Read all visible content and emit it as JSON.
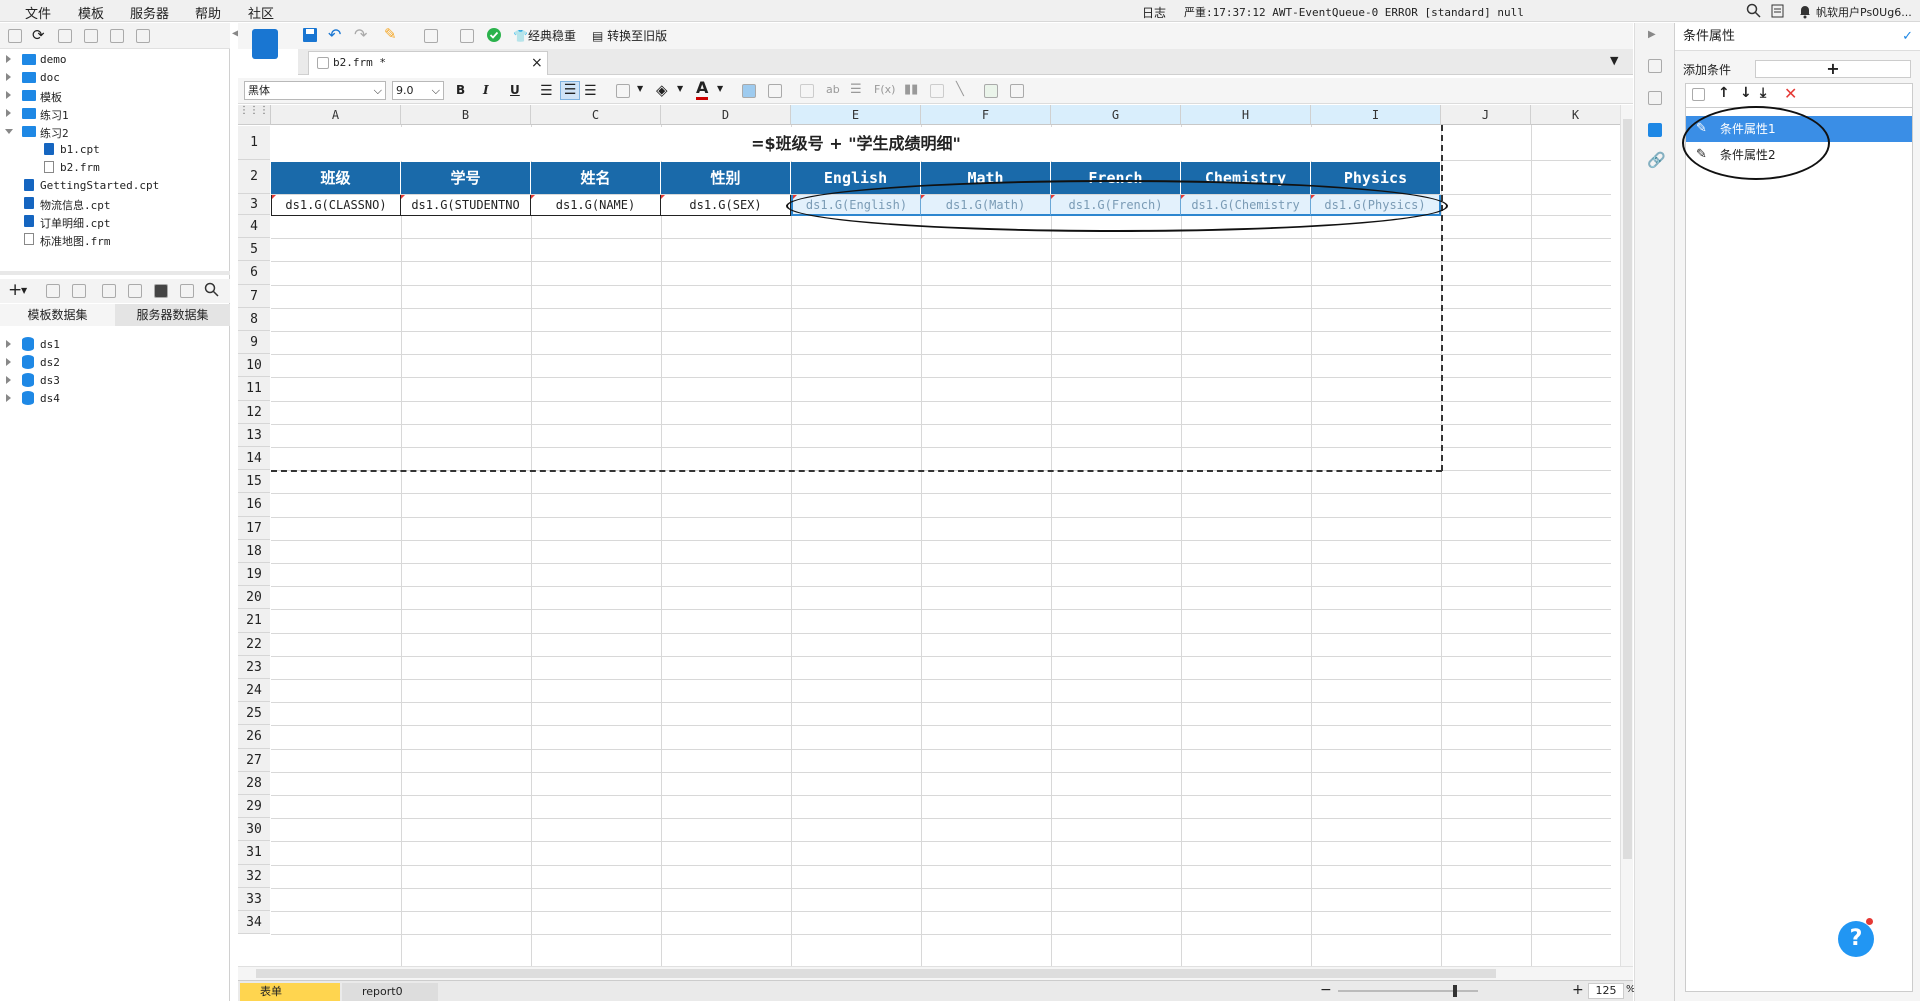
{
  "menubar": {
    "items": [
      "文件",
      "模板",
      "服务器",
      "帮助",
      "社区"
    ],
    "log_label": "日志",
    "log_text": "严重:17:37:12 AWT-EventQueue-0 ERROR [standard] null",
    "user": "帆软用户Ps0Ug6..."
  },
  "tree": {
    "items": [
      "demo",
      "doc",
      "模板",
      "练习1",
      "练习2",
      "b1.cpt",
      "b2.frm",
      "GettingStarted.cpt",
      "物流信息.cpt",
      "订单明细.cpt",
      "标准地图.frm"
    ]
  },
  "datasets": {
    "tabs": [
      "模板数据集",
      "服务器数据集"
    ],
    "items": [
      "ds1",
      "ds2",
      "ds3",
      "ds4"
    ]
  },
  "toolbar": {
    "classic_label": "经典稳重",
    "convert_label": "转换至旧版",
    "font_name": "黑体",
    "font_size": "9.0"
  },
  "tab": {
    "title": "b2.frm *",
    "close": "×"
  },
  "sheet": {
    "columns": [
      "A",
      "B",
      "C",
      "D",
      "E",
      "F",
      "G",
      "H",
      "I",
      "J",
      "K"
    ],
    "rows": [
      "1",
      "2",
      "3",
      "4",
      "5",
      "6",
      "7",
      "8",
      "9",
      "10",
      "11",
      "12",
      "13",
      "14",
      "15",
      "16",
      "17",
      "18",
      "19",
      "20",
      "21",
      "22",
      "23",
      "24",
      "25",
      "26",
      "27",
      "28",
      "29",
      "30",
      "31",
      "32",
      "33",
      "34"
    ],
    "title": "=$班级号 + \"学生成绩明细\"",
    "headers": [
      "班级",
      "学号",
      "姓名",
      "性别",
      "English",
      "Math",
      "French",
      "Chemistry",
      "Physics"
    ],
    "data": [
      "ds1.G(CLASSNO)",
      "ds1.G(STUDENTNO",
      "ds1.G(NAME)",
      "ds1.G(SEX)",
      "ds1.G(English)",
      "ds1.G(Math)",
      "ds1.G(French)",
      "ds1.G(Chemistry",
      "ds1.G(Physics)"
    ]
  },
  "bottom": {
    "sheets": [
      "表单",
      "report0"
    ],
    "zoom": "125",
    "zoom_unit": "%"
  },
  "right_panel": {
    "title": "条件属性",
    "add_label": "添加条件",
    "add_symbol": "+",
    "conditions": [
      "条件属性1",
      "条件属性2"
    ]
  },
  "help_symbol": "?"
}
